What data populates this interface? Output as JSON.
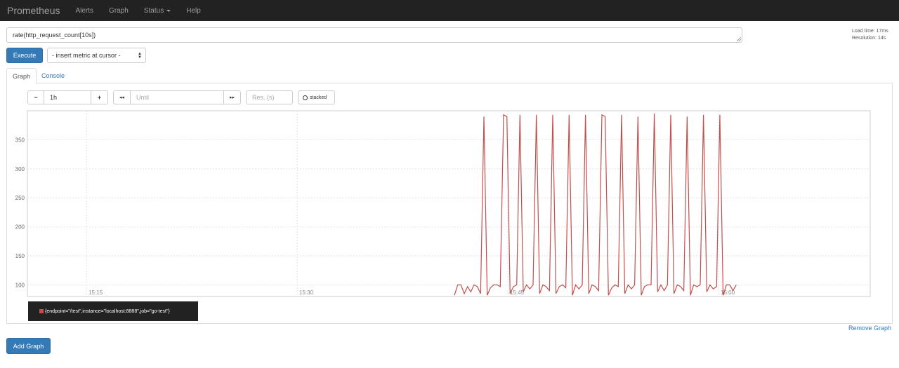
{
  "navbar": {
    "brand": "Prometheus",
    "items": [
      {
        "label": "Alerts"
      },
      {
        "label": "Graph"
      },
      {
        "label": "Status",
        "dropdown": true
      },
      {
        "label": "Help"
      }
    ]
  },
  "query": {
    "expression": "rate(http_request_count[10s])",
    "load_time": "Load time: 17ms",
    "resolution": "Resolution: 14s",
    "execute_label": "Execute",
    "metric_select": "- insert metric at cursor -"
  },
  "tabs": [
    {
      "label": "Graph",
      "active": true
    },
    {
      "label": "Console",
      "active": false
    }
  ],
  "controls": {
    "minus": "−",
    "range": "1h",
    "plus": "+",
    "back": "◂◂",
    "until_placeholder": "Until",
    "forward": "▸▸",
    "res_placeholder": "Res. (s)",
    "stacked_label": "stacked"
  },
  "chart_data": {
    "type": "line",
    "y_ticks": [
      100,
      150,
      200,
      250,
      300,
      350
    ],
    "ylim": [
      80,
      400
    ],
    "x_tick_labels": [
      "15:15",
      "15:30",
      "15:45",
      "16:00"
    ],
    "x_tick_minutes": [
      15,
      30,
      45,
      60
    ],
    "xlim_minutes": [
      10.8,
      70.8
    ],
    "grid": true,
    "color": "#c0504d",
    "series": [
      {
        "name": "{endpoint=\"/test\",instance=\"localhost:8888\",job=\"go-test\"}",
        "start_minute": 41.2,
        "step_minutes": 0.2333,
        "values": [
          82,
          100,
          100,
          85,
          97,
          88,
          100,
          97,
          85,
          390,
          82,
          95,
          100,
          100,
          97,
          393,
          390,
          85,
          97,
          100,
          393,
          88,
          100,
          93,
          100,
          393,
          85,
          100,
          97,
          90,
          393,
          85,
          97,
          100,
          95,
          393,
          82,
          100,
          93,
          100,
          393,
          85,
          100,
          97,
          90,
          393,
          390,
          82,
          95,
          100,
          97,
          393,
          85,
          100,
          93,
          100,
          390,
          82,
          97,
          100,
          100,
          395,
          88,
          100,
          90,
          100,
          393,
          85,
          100,
          97,
          90,
          390,
          82,
          100,
          97,
          100,
          393,
          88,
          100,
          93,
          97,
          393,
          82,
          100,
          100,
          90,
          100
        ]
      }
    ]
  },
  "remove_graph": "Remove Graph",
  "add_graph": "Add Graph"
}
